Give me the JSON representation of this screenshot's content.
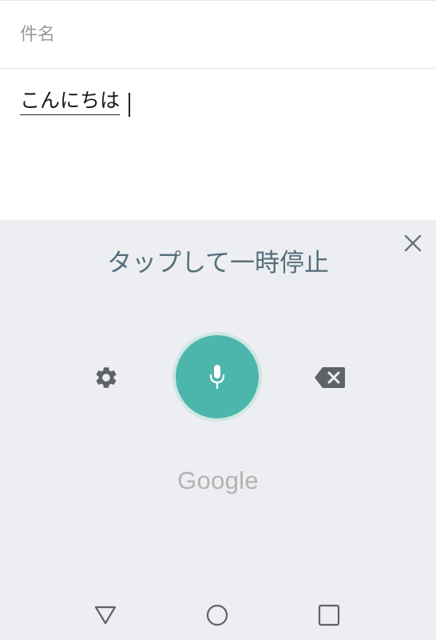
{
  "compose": {
    "subject_placeholder": "件名",
    "body_text": "こんにちは"
  },
  "voice_input": {
    "status": "タップして一時停止",
    "brand": "Google",
    "accent_color": "#4db6ac",
    "icons": {
      "close": "close-icon",
      "settings": "gear-icon",
      "microphone": "microphone-icon",
      "backspace": "backspace-icon"
    }
  },
  "navigation": {
    "icons": [
      "back-triangle-icon",
      "home-circle-icon",
      "recents-square-icon"
    ]
  }
}
